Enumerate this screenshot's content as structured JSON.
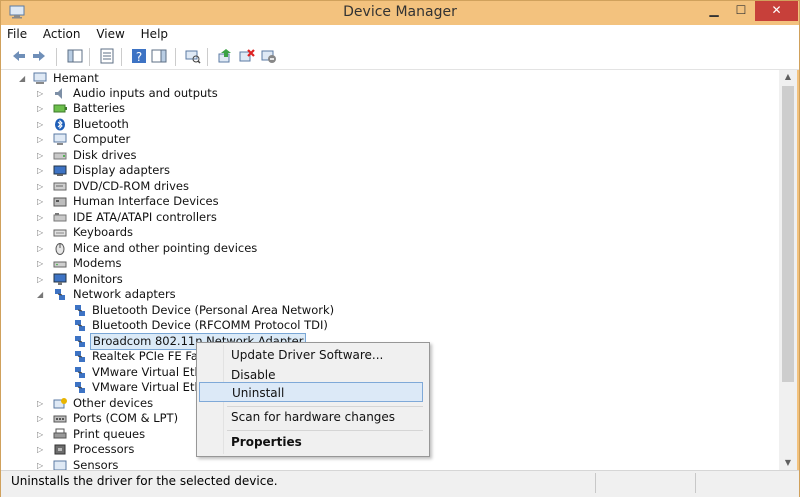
{
  "window": {
    "title": "Device Manager"
  },
  "menubar": [
    "File",
    "Action",
    "View",
    "Help"
  ],
  "toolbar": {
    "buttons": [
      "back-arrow-icon",
      "forward-arrow-icon",
      "show-hide-console-tree-icon",
      "properties-icon",
      "help-icon",
      "action-pane-icon",
      "scan-hardware-icon",
      "update-driver-icon",
      "uninstall-icon",
      "disable-icon"
    ]
  },
  "tree": {
    "root": "Hemant",
    "categories": [
      {
        "label": "Audio inputs and outputs",
        "icon": "speaker-icon"
      },
      {
        "label": "Batteries",
        "icon": "battery-icon"
      },
      {
        "label": "Bluetooth",
        "icon": "bluetooth-icon"
      },
      {
        "label": "Computer",
        "icon": "computer-icon"
      },
      {
        "label": "Disk drives",
        "icon": "disk-drive-icon"
      },
      {
        "label": "Display adapters",
        "icon": "display-adapter-icon"
      },
      {
        "label": "DVD/CD-ROM drives",
        "icon": "dvd-drive-icon"
      },
      {
        "label": "Human Interface Devices",
        "icon": "hid-icon"
      },
      {
        "label": "IDE ATA/ATAPI controllers",
        "icon": "ide-controller-icon"
      },
      {
        "label": "Keyboards",
        "icon": "keyboard-icon"
      },
      {
        "label": "Mice and other pointing devices",
        "icon": "mouse-icon"
      },
      {
        "label": "Modems",
        "icon": "modem-icon"
      },
      {
        "label": "Monitors",
        "icon": "monitor-icon"
      },
      {
        "label": "Network adapters",
        "icon": "network-adapter-icon",
        "expanded": true
      }
    ],
    "network_children": [
      "Bluetooth Device (Personal Area Network)",
      "Bluetooth Device (RFCOMM Protocol TDI)",
      "Broadcom 802.11n Network Adapter",
      "Realtek PCIe FE Fam",
      "VMware Virtual Ethe",
      "VMware Virtual Ethe"
    ],
    "after": [
      {
        "label": "Other devices",
        "icon": "other-devices-icon"
      },
      {
        "label": "Ports (COM & LPT)",
        "icon": "port-icon"
      },
      {
        "label": "Print queues",
        "icon": "printer-icon"
      },
      {
        "label": "Processors",
        "icon": "processor-icon"
      },
      {
        "label": "Sensors",
        "icon": "sensor-icon"
      }
    ]
  },
  "context_menu": {
    "items": [
      "Update Driver Software...",
      "Disable",
      "Uninstall",
      "Scan for hardware changes",
      "Properties"
    ],
    "hovered": "Uninstall"
  },
  "status": {
    "text": "Uninstalls the driver for the selected device."
  },
  "colors": {
    "titlebar": "#f3c27e",
    "close": "#c7403a",
    "highlight": "#dbeaf7"
  }
}
